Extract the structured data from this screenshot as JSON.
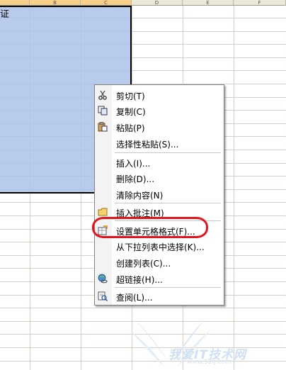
{
  "sheet": {
    "columns": [
      "",
      "B",
      "C",
      "D",
      "E",
      "F"
    ],
    "selected_cell_text": "证"
  },
  "context_menu": {
    "items": [
      {
        "label": "剪切(T)",
        "icon": "scissors-icon"
      },
      {
        "label": "复制(C)",
        "icon": "copy-icon"
      },
      {
        "label": "粘贴(P)",
        "icon": "paste-icon"
      },
      {
        "label": "选择性粘贴(S)...",
        "icon": ""
      },
      {
        "label": "插入(I)...",
        "icon": ""
      },
      {
        "label": "删除(D)...",
        "icon": ""
      },
      {
        "label": "清除内容(N)",
        "icon": ""
      },
      {
        "label": "插入批注(M)",
        "icon": "comment-icon"
      },
      {
        "label": "设置单元格格式(F)...",
        "icon": "format-cells-icon"
      },
      {
        "label": "从下拉列表中选择(K)...",
        "icon": ""
      },
      {
        "label": "创建列表(C)...",
        "icon": ""
      },
      {
        "label": "超链接(H)...",
        "icon": "hyperlink-icon"
      },
      {
        "label": "查阅(L)...",
        "icon": "lookup-icon"
      }
    ],
    "highlight_color": "#e3141b"
  },
  "watermark": {
    "text": "我爱IT技术网",
    "url": "www.52ij.com"
  },
  "colors": {
    "selection": "#adc2e7",
    "header": "#ece9d8"
  }
}
